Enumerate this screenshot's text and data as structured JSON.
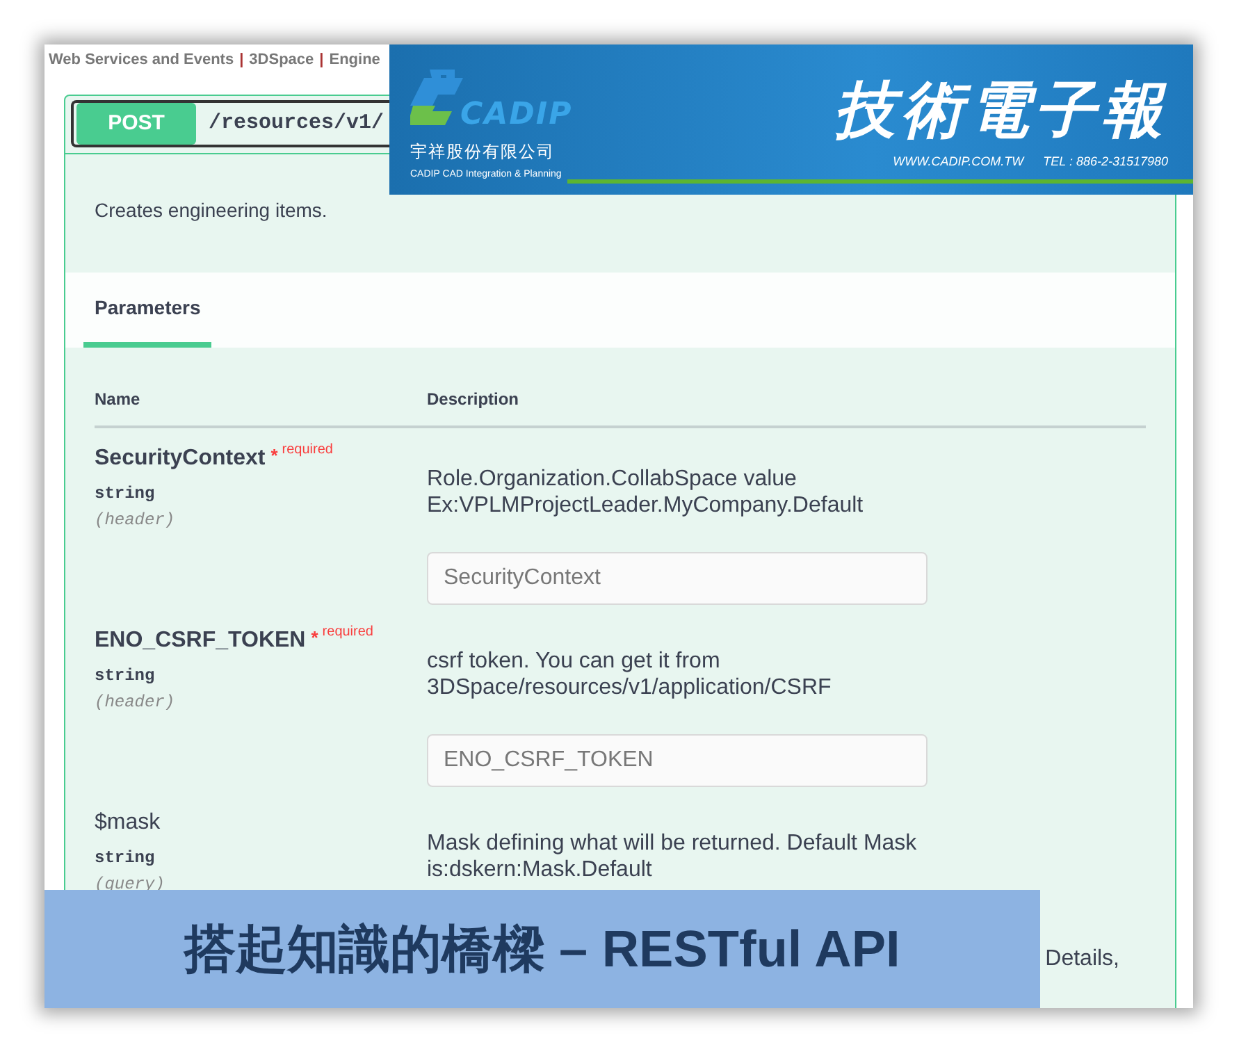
{
  "breadcrumb": [
    {
      "kind": "link",
      "text": "Web Services and Events"
    },
    {
      "kind": "separator",
      "text": "|"
    },
    {
      "kind": "link",
      "text": "3DSpace"
    },
    {
      "kind": "separator",
      "text": "|"
    },
    {
      "kind": "link",
      "text": "Engine"
    }
  ],
  "operation": {
    "method": "POST",
    "path": "/resources/v1/",
    "description": "Creates engineering items."
  },
  "tabs": [
    {
      "label": "Parameters",
      "selected": true
    }
  ],
  "table": {
    "columns": [
      "Name",
      "Description"
    ],
    "rows": [
      {
        "name": "SecurityContext",
        "required": true,
        "required_mark": "*",
        "required_label": "required",
        "type": "string",
        "location": "(header)",
        "description": [
          "Role.Organization.CollabSpace value",
          "Ex:VPLMProjectLeader.MyCompany.Default"
        ],
        "placeholder": "SecurityContext"
      },
      {
        "name": "ENO_CSRF_TOKEN",
        "required": true,
        "required_mark": "*",
        "required_label": "required",
        "type": "string",
        "location": "(header)",
        "description": [
          "csrf token. You can get it from",
          "3DSpace/resources/v1/application/CSRF"
        ],
        "placeholder": "ENO_CSRF_TOKEN"
      },
      {
        "name": "$mask",
        "required": false,
        "type": "string",
        "location": "(query)",
        "description": [
          "Mask defining what will be returned. Default Mask",
          "is:dskern:Mask.Default"
        ]
      },
      {
        "description": [
          "Details,"
        ]
      }
    ]
  },
  "banner": {
    "logo_text": "CADIP",
    "company": "宇祥股份有限公司",
    "tagline": "CADIP CAD Integration & Planning",
    "title": "技術電子報",
    "website": "WWW.CADIP.COM.TW",
    "phone": "TEL : 886-2-31517980"
  },
  "caption": "搭起知識的橋樑 – RESTful API"
}
